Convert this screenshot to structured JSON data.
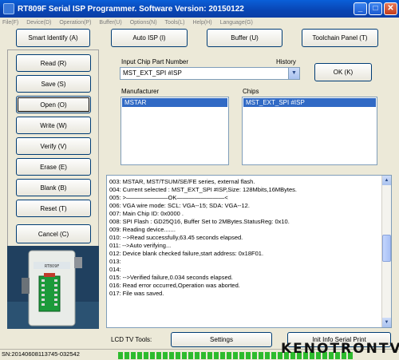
{
  "window": {
    "title": "RT809F Serial ISP Programmer. Software Version: 20150122"
  },
  "menu": [
    "File(F)",
    "Device(D)",
    "Operation(P)",
    "Buffer(U)",
    "Options(N)",
    "Tools(L)",
    "Help(H)",
    "Language(G)"
  ],
  "toolbar": {
    "smart_identify": "Smart Identify (A)",
    "auto_isp": "Auto ISP (I)",
    "buffer": "Buffer (U)",
    "toolchain": "Toolchain Panel (T)"
  },
  "left_buttons": [
    "Read (R)",
    "Save (S)",
    "Open (O)",
    "Write (W)",
    "Verify (V)",
    "Erase (E)",
    "Blank (B)",
    "Reset (T)"
  ],
  "cancel": "Cancel (C)",
  "chip_input": {
    "label": "Input Chip Part Number",
    "history_label": "History",
    "value": "MST_EXT_SPI #ISP",
    "ok": "OK (K)"
  },
  "manufacturer": {
    "label": "Manufacturer",
    "selected": "MSTAR"
  },
  "chips": {
    "label": "Chips",
    "selected": "MST_EXT_SPI #ISP"
  },
  "log": [
    "003:  MSTAR, MST/TSUM/SE/FE series, external flash.",
    "004:  Current selected : MST_EXT_SPI #ISP,Size: 128Mbits,16MBytes.",
    "005:  >———————OK————————<",
    "006:  VGA wire mode: SCL: VGA--15; SDA: VGA--12.",
    "007:  Main Chip ID: 0x0000 .",
    "008:  SPI Flash : GD25Q16, Buffer Set to 2MBytes.StatusReg: 0x10.",
    "009:  Reading device.......",
    "010:  -->Read successfully,63.45 seconds elapsed.",
    "011:  -->Auto verifying...",
    "012:  Device blank checked failure,start address: 0x18F01.",
    "013:",
    "014:",
    "015:  -->Verified failure,0.034 seconds elapsed.",
    "016:  Read error occurred,Operation was aborted.",
    "017:  File was saved."
  ],
  "bottom": {
    "lcd_label": "LCD TV Tools:",
    "settings": "Settings",
    "init_info": "Init Info Serial Print"
  },
  "status": {
    "serial": "SN:20140608113745-032542",
    "progress_percent": 100
  },
  "device_photo": {
    "label": "RT809F Serial ISP Programmer"
  },
  "watermark": "KENOTRONTV",
  "colors": {
    "titlebar": "#0a4fc6",
    "selection": "#316ac5",
    "progress": "#2dbb2d"
  }
}
